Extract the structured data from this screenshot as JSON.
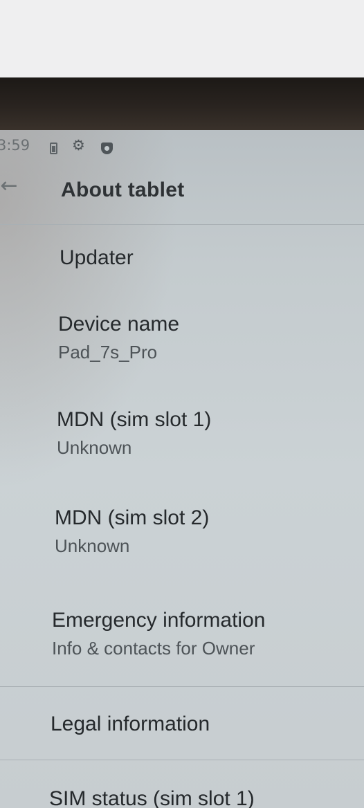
{
  "status_bar": {
    "time": "3:59",
    "icons": [
      "battery-icon",
      "gear-icon",
      "shield-icon"
    ]
  },
  "toolbar": {
    "back_icon": "arrow-left-icon",
    "back_glyph": "←",
    "title": "About tablet"
  },
  "items": [
    {
      "title": "Updater",
      "summary": ""
    },
    {
      "title": "Device name",
      "summary": "Pad_7s_Pro"
    },
    {
      "title": "MDN (sim slot 1)",
      "summary": "Unknown"
    },
    {
      "title": "MDN (sim slot 2)",
      "summary": "Unknown"
    },
    {
      "title": "Emergency information",
      "summary": "Info & contacts for Owner"
    },
    {
      "title": "Legal information",
      "summary": ""
    },
    {
      "title": "SIM status (sim slot 1)",
      "summary": ""
    }
  ],
  "colors": {
    "screen_bg": "#c4cbce",
    "title_text": "#2e3235",
    "summary_text": "#4d5357",
    "divider": "#a9b0b4"
  }
}
